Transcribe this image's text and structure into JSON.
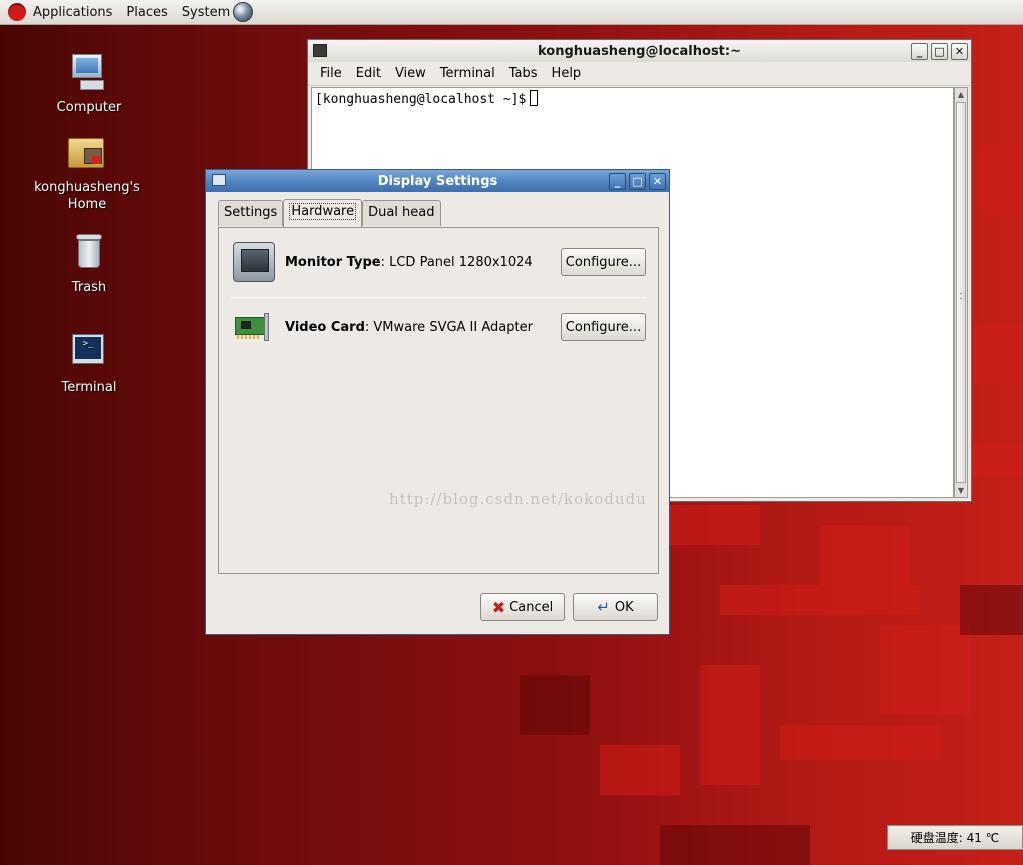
{
  "top_panel": {
    "menus": [
      "Applications",
      "Places",
      "System"
    ]
  },
  "desktop_icons": [
    {
      "label": "Computer"
    },
    {
      "label": "konghuasheng's\nHome"
    },
    {
      "label": "Trash"
    },
    {
      "label": "Terminal"
    }
  ],
  "terminal": {
    "title": "konghuasheng@localhost:~",
    "menu": [
      "File",
      "Edit",
      "View",
      "Terminal",
      "Tabs",
      "Help"
    ],
    "prompt": "[konghuasheng@localhost ~]$"
  },
  "dialog": {
    "title": "Display Settings",
    "tabs": [
      "Settings",
      "Hardware",
      "Dual head"
    ],
    "selected_tab": "Hardware",
    "monitor": {
      "label": "Monitor Type",
      "value": ": LCD Panel 1280x1024",
      "button": "Configure..."
    },
    "video": {
      "label": "Video Card",
      "value": ": VMware SVGA II Adapter",
      "button": "Configure..."
    },
    "cancel": "Cancel",
    "ok": "OK"
  },
  "watermark": "http://blog.csdn.net/kokodudu",
  "status_widget": {
    "text": "硬盘温度: 41 ℃"
  },
  "window_buttons": {
    "minimize": "_",
    "maximize": "□",
    "close": "✕"
  }
}
